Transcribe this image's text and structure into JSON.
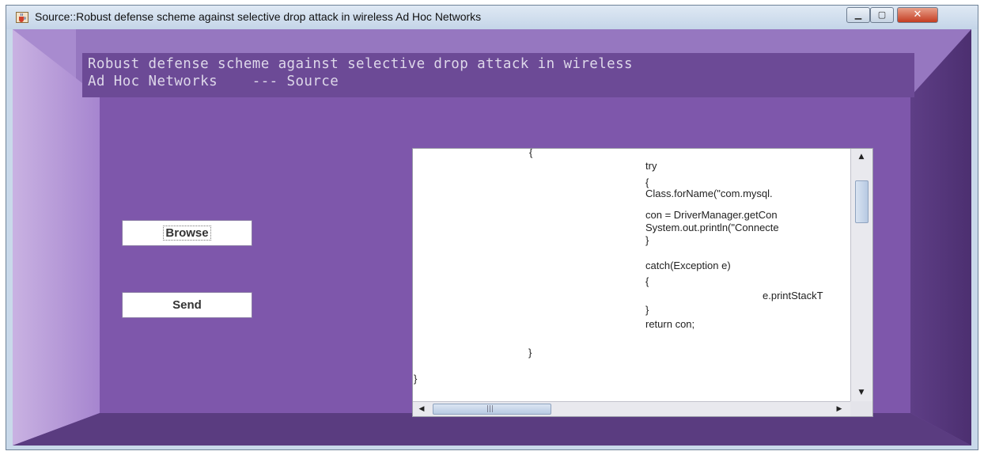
{
  "window": {
    "title": "Source::Robust defense scheme against selective drop attack in wireless Ad Hoc Networks",
    "app_icon": "java-cup-icon",
    "controls": {
      "minimize": "minimize-icon",
      "maximize": "maximize-icon",
      "close": "close-icon"
    }
  },
  "header": {
    "title": "Robust defense scheme against selective drop attack in wireless\nAd Hoc Networks    --- Source"
  },
  "buttons": {
    "browse_label": "Browse",
    "send_label": "Send"
  },
  "code_view": {
    "lines": [
      "{",
      "try",
      "{",
      "Class.forName(\"com.mysql.",
      "con = DriverManager.getCon",
      "System.out.println(\"Connecte",
      "}",
      "catch(Exception e)",
      "{",
      "e.printStackT",
      "}",
      "return con;",
      "}",
      "}"
    ],
    "scrollbar_icons": {
      "up": "up-arrow-icon",
      "down": "down-arrow-icon",
      "left": "left-arrow-icon",
      "right": "right-arrow-icon"
    }
  },
  "colors": {
    "background_purple": "#7e57ab",
    "header_purple": "#6c4a96",
    "title_bar": "#c4d5e8",
    "close_red": "#c43d22"
  }
}
